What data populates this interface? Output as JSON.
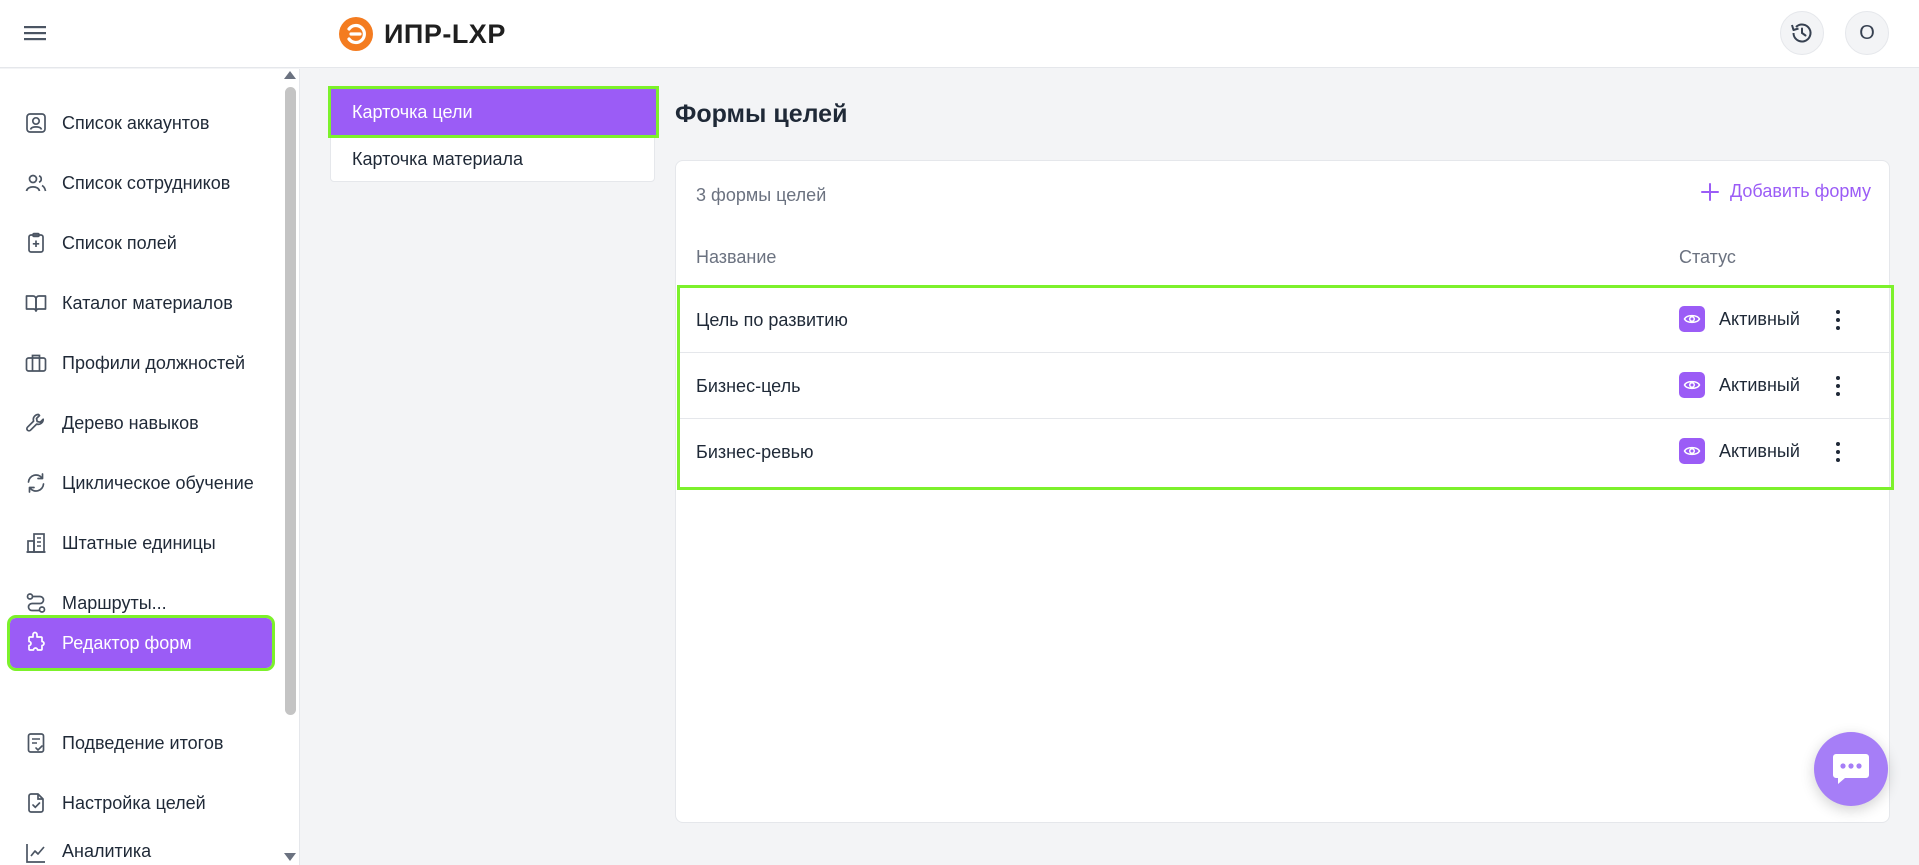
{
  "header": {
    "logo_text": "ИПР-LXP",
    "avatar_letter": "О"
  },
  "sidebar": {
    "items": [
      {
        "label": "Список аккаунтов",
        "icon": "account-box-icon"
      },
      {
        "label": "Список сотрудников",
        "icon": "users-icon"
      },
      {
        "label": "Список полей",
        "icon": "clipboard-plus-icon"
      },
      {
        "label": "Каталог материалов",
        "icon": "book-open-icon"
      },
      {
        "label": "Профили должностей",
        "icon": "briefcase-icon"
      },
      {
        "label": "Дерево навыков",
        "icon": "wrench-icon"
      },
      {
        "label": "Циклическое обучение",
        "icon": "refresh-icon"
      },
      {
        "label": "Штатные единицы",
        "icon": "building-icon"
      },
      {
        "label": "Маршруты...",
        "icon": "route-icon"
      },
      {
        "label": "Редактор форм",
        "icon": "puzzle-icon",
        "active": true
      },
      {
        "label": "Подведение итогов",
        "icon": "checklist-icon"
      },
      {
        "label": "Настройка целей",
        "icon": "file-check-icon"
      },
      {
        "label": "Аналитика",
        "icon": "chart-line-icon"
      }
    ]
  },
  "subnav": {
    "items": [
      {
        "label": "Карточка цели",
        "active": true
      },
      {
        "label": "Карточка материала"
      }
    ]
  },
  "main": {
    "title": "Формы целей",
    "count_label": "3 формы целей",
    "add_label": "Добавить форму",
    "columns": {
      "name": "Название",
      "status": "Статус"
    },
    "rows": [
      {
        "name": "Цель по развитию",
        "status": "Активный"
      },
      {
        "name": "Бизнес-цель",
        "status": "Активный"
      },
      {
        "name": "Бизнес-ревью",
        "status": "Активный"
      }
    ]
  },
  "colors": {
    "accent": "#9b5cf6",
    "highlight": "#7cf12b",
    "logo_orange": "#f47c20"
  }
}
